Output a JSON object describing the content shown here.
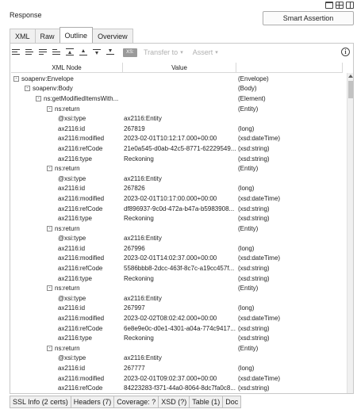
{
  "panel_title": "Response",
  "smart_assertion_label": "Smart Assertion",
  "tabs": [
    {
      "label": "XML",
      "active": false
    },
    {
      "label": "Raw",
      "active": false
    },
    {
      "label": "Outline",
      "active": true
    },
    {
      "label": "Overview",
      "active": false
    }
  ],
  "toolbar": {
    "xs_label": "XS:",
    "transfer_label": "Transfer to",
    "assert_label": "Assert",
    "info_label": "i"
  },
  "columns": {
    "node": "XML Node",
    "value": "Value",
    "type": ""
  },
  "rows": [
    {
      "node": "soapenv:Envelope",
      "level": 0,
      "toggle": "-",
      "value": "",
      "type": "(Envelope)"
    },
    {
      "node": "soapenv:Body",
      "level": 1,
      "toggle": "-",
      "value": "",
      "type": "(Body)"
    },
    {
      "node": "ns:getModifiedItemsWith...",
      "level": 2,
      "toggle": "-",
      "value": "",
      "type": "(Element)"
    },
    {
      "node": "ns:return",
      "level": 3,
      "toggle": "-",
      "value": "",
      "type": "(Entity)"
    },
    {
      "node": "@xsi:type",
      "level": 4,
      "toggle": "",
      "value": "ax2116:Entity",
      "type": ""
    },
    {
      "node": "ax2116:id",
      "level": 4,
      "toggle": "",
      "value": "267819",
      "type": "(long)"
    },
    {
      "node": "ax2116:modified",
      "level": 4,
      "toggle": "",
      "value": "2023-02-01T10:12:17.000+00:00",
      "type": "(xsd:dateTime)"
    },
    {
      "node": "ax2116:refCode",
      "level": 4,
      "toggle": "",
      "value": "21e0a545-d0ab-42c5-8771-62229549...",
      "type": "(xsd:string)"
    },
    {
      "node": "ax2116:type",
      "level": 4,
      "toggle": "",
      "value": "Reckoning",
      "type": "(xsd:string)"
    },
    {
      "node": "ns:return",
      "level": 3,
      "toggle": "-",
      "value": "",
      "type": "(Entity)"
    },
    {
      "node": "@xsi:type",
      "level": 4,
      "toggle": "",
      "value": "ax2116:Entity",
      "type": ""
    },
    {
      "node": "ax2116:id",
      "level": 4,
      "toggle": "",
      "value": "267826",
      "type": "(long)"
    },
    {
      "node": "ax2116:modified",
      "level": 4,
      "toggle": "",
      "value": "2023-02-01T10:17:00.000+00:00",
      "type": "(xsd:dateTime)"
    },
    {
      "node": "ax2116:refCode",
      "level": 4,
      "toggle": "",
      "value": "df896937-9c0d-472a-b47a-b5983908...",
      "type": "(xsd:string)"
    },
    {
      "node": "ax2116:type",
      "level": 4,
      "toggle": "",
      "value": "Reckoning",
      "type": "(xsd:string)"
    },
    {
      "node": "ns:return",
      "level": 3,
      "toggle": "-",
      "value": "",
      "type": "(Entity)"
    },
    {
      "node": "@xsi:type",
      "level": 4,
      "toggle": "",
      "value": "ax2116:Entity",
      "type": ""
    },
    {
      "node": "ax2116:id",
      "level": 4,
      "toggle": "",
      "value": "267996",
      "type": "(long)"
    },
    {
      "node": "ax2116:modified",
      "level": 4,
      "toggle": "",
      "value": "2023-02-01T14:02:37.000+00:00",
      "type": "(xsd:dateTime)"
    },
    {
      "node": "ax2116:refCode",
      "level": 4,
      "toggle": "",
      "value": "5586bbb8-2dcc-463f-8c7c-a19cc457f...",
      "type": "(xsd:string)"
    },
    {
      "node": "ax2116:type",
      "level": 4,
      "toggle": "",
      "value": "Reckoning",
      "type": "(xsd:string)"
    },
    {
      "node": "ns:return",
      "level": 3,
      "toggle": "-",
      "value": "",
      "type": "(Entity)"
    },
    {
      "node": "@xsi:type",
      "level": 4,
      "toggle": "",
      "value": "ax2116:Entity",
      "type": ""
    },
    {
      "node": "ax2116:id",
      "level": 4,
      "toggle": "",
      "value": "267997",
      "type": "(long)"
    },
    {
      "node": "ax2116:modified",
      "level": 4,
      "toggle": "",
      "value": "2023-02-02T08:02:42.000+00:00",
      "type": "(xsd:dateTime)"
    },
    {
      "node": "ax2116:refCode",
      "level": 4,
      "toggle": "",
      "value": "6e8e9e0c-d0e1-4301-a04a-774c9417...",
      "type": "(xsd:string)"
    },
    {
      "node": "ax2116:type",
      "level": 4,
      "toggle": "",
      "value": "Reckoning",
      "type": "(xsd:string)"
    },
    {
      "node": "ns:return",
      "level": 3,
      "toggle": "-",
      "value": "",
      "type": "(Entity)"
    },
    {
      "node": "@xsi:type",
      "level": 4,
      "toggle": "",
      "value": "ax2116:Entity",
      "type": ""
    },
    {
      "node": "ax2116:id",
      "level": 4,
      "toggle": "",
      "value": "267777",
      "type": "(long)"
    },
    {
      "node": "ax2116:modified",
      "level": 4,
      "toggle": "",
      "value": "2023-02-01T09:02:37.000+00:00",
      "type": "(xsd:dateTime)"
    },
    {
      "node": "ax2116:refCode",
      "level": 4,
      "toggle": "",
      "value": "84223283-f371-44a0-8064-8dc7fa0c8...",
      "type": "(xsd:string)"
    }
  ],
  "bottom_tabs": [
    {
      "label": "SSL Info (2 certs)"
    },
    {
      "label": "Headers (7)"
    },
    {
      "label": "Coverage: ?"
    },
    {
      "label": "XSD (?)"
    },
    {
      "label": "Table (1)"
    },
    {
      "label": "Doc"
    }
  ]
}
